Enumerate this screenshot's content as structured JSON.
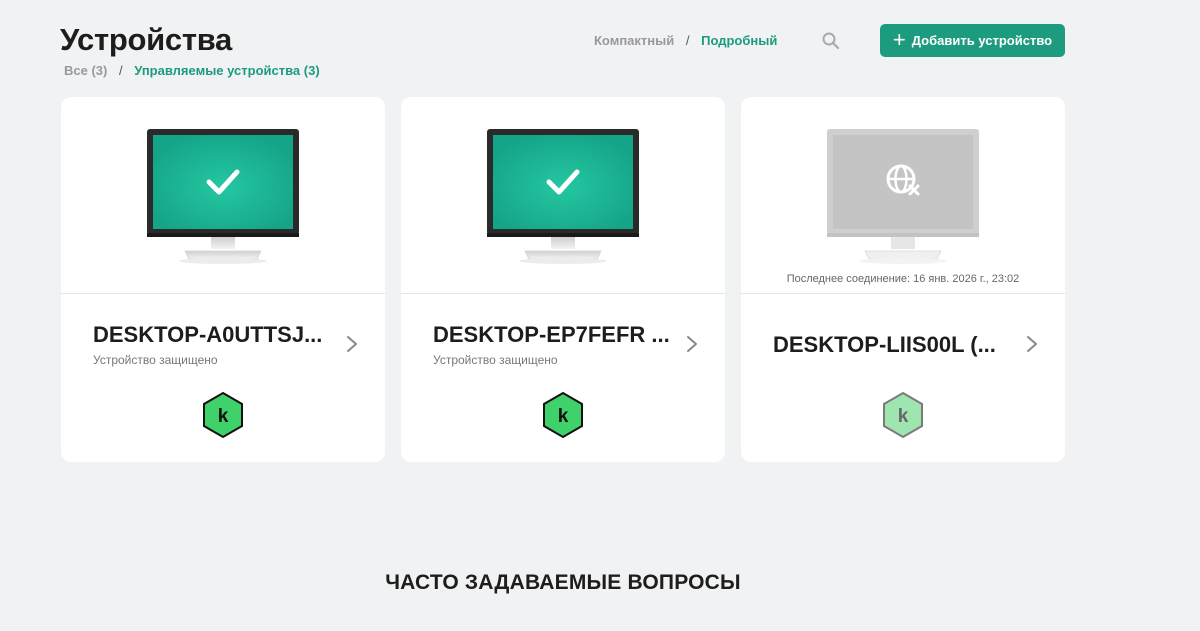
{
  "header": {
    "title": "Устройства",
    "breadcrumb": {
      "all": "Все (3)",
      "separator": "/",
      "managed": "Управляемые устройства (3)"
    },
    "view_toggle": {
      "compact": "Компактный",
      "separator": "/",
      "detailed": "Подробный",
      "selected": "Подробный"
    },
    "search_icon": "search-icon",
    "add_device_button": "Добавить устройство"
  },
  "colors": {
    "accent": "#1d9b7e",
    "screen_green": "#1db394",
    "badge_green": "#3fd16a",
    "offline_gray": "#c8c8c8"
  },
  "devices": [
    {
      "name": "DESKTOP-A0UTTSJ...",
      "status": "Устройство защищено",
      "state": "protected",
      "last_connection": ""
    },
    {
      "name": "DESKTOP-EP7FEFR ...",
      "status": "Устройство защищено",
      "state": "protected",
      "last_connection": ""
    },
    {
      "name": "DESKTOP-LIIS00L (...",
      "status": "",
      "state": "offline",
      "last_connection": "Последнее соединение:  16 янв. 2026 г., 23:02"
    }
  ],
  "faq": {
    "title": "ЧАСТО ЗАДАВАЕМЫЕ ВОПРОСЫ"
  }
}
